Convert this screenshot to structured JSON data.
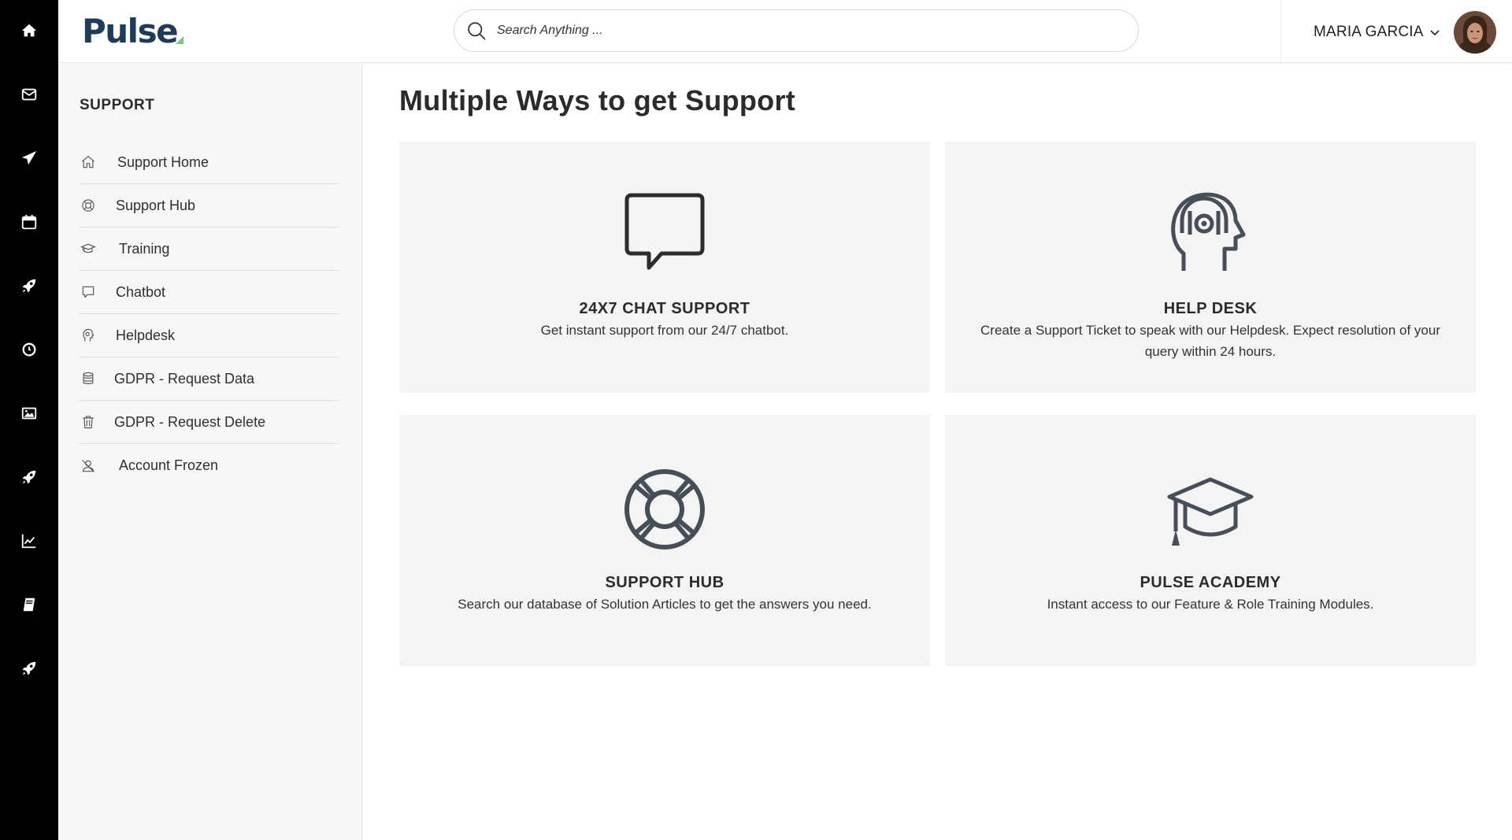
{
  "app": {
    "logo_text": "Pulse",
    "brand_color": "#1f3b57",
    "accent_color": "#7bc67e"
  },
  "rail": {
    "items": [
      {
        "icon": "home-icon"
      },
      {
        "icon": "mail-icon"
      },
      {
        "icon": "send-icon"
      },
      {
        "icon": "calendar-icon"
      },
      {
        "icon": "rocket-icon"
      },
      {
        "icon": "clock-icon"
      },
      {
        "icon": "image-icon"
      },
      {
        "icon": "rocket-icon"
      },
      {
        "icon": "line-chart-icon"
      },
      {
        "icon": "book-icon"
      },
      {
        "icon": "rocket-icon"
      }
    ]
  },
  "header": {
    "search_placeholder": "Search Anything ...",
    "user_name": "MARIA GARCIA"
  },
  "sidebar": {
    "title": "SUPPORT",
    "items": [
      {
        "label": "Support Home",
        "icon": "home-icon"
      },
      {
        "label": "Support Hub",
        "icon": "lifebuoy-icon"
      },
      {
        "label": "Training",
        "icon": "graduation-cap-icon"
      },
      {
        "label": "Chatbot",
        "icon": "chat-bubble-icon"
      },
      {
        "label": "Helpdesk",
        "icon": "headset-head-icon"
      },
      {
        "label": "GDPR - Request Data",
        "icon": "database-icon"
      },
      {
        "label": "GDPR - Request Delete",
        "icon": "trash-icon"
      },
      {
        "label": "Account Frozen",
        "icon": "user-slash-icon"
      }
    ]
  },
  "main": {
    "title": "Multiple Ways to get Support",
    "cards": [
      {
        "title": "24X7 CHAT SUPPORT",
        "description": "Get instant support from our 24/7 chatbot.",
        "icon": "chat-bubble-icon"
      },
      {
        "title": "HELP DESK",
        "description": "Create a Support Ticket to speak with our Helpdesk. Expect resolution of your query within 24 hours.",
        "icon": "headset-head-icon"
      },
      {
        "title": "SUPPORT HUB",
        "description": "Search our database of Solution Articles to get the answers you need.",
        "icon": "lifebuoy-icon"
      },
      {
        "title": "PULSE ACADEMY",
        "description": "Instant access to our Feature & Role Training Modules.",
        "icon": "graduation-cap-icon"
      }
    ]
  }
}
